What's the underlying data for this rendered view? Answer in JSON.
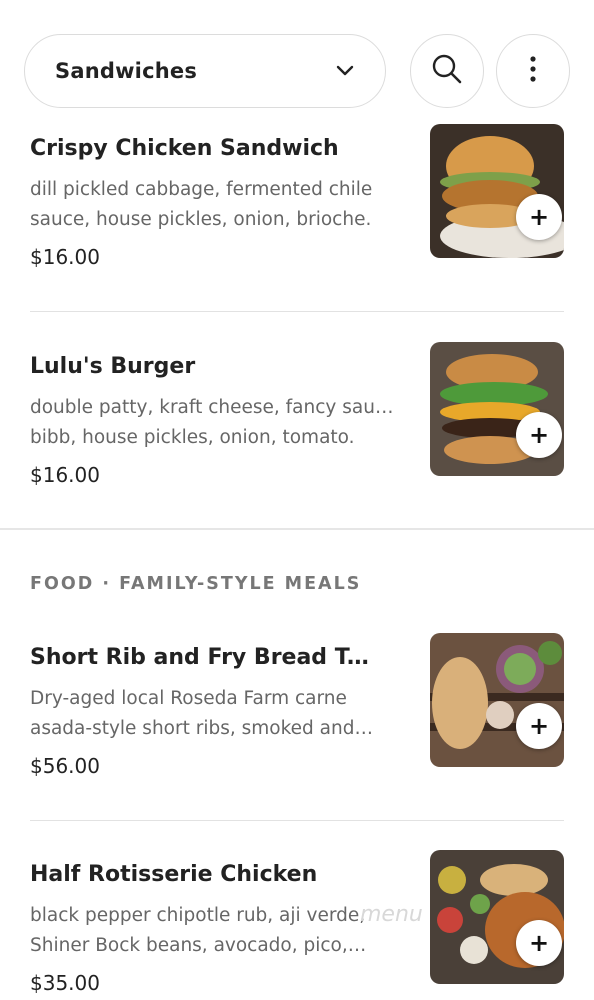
{
  "header": {
    "category_label": "Sandwiches",
    "icons": {
      "dropdown": "chevron-down-icon",
      "search": "search-icon",
      "more": "more-vertical-icon"
    }
  },
  "section_heading": "FOOD · FAMILY-STYLE MEALS",
  "items": [
    {
      "name": "Crispy Chicken Sandwich",
      "desc_line1": "dill pickled cabbage, fermented chile",
      "desc_line2": "sauce, house pickles, onion, brioche.",
      "price": "$16.00",
      "add_label": "+"
    },
    {
      "name": "Lulu's Burger",
      "desc_line1": "double patty, kraft cheese, fancy sauce,",
      "desc_line2": "bibb, house pickles, onion, tomato.",
      "price": "$16.00",
      "add_label": "+"
    },
    {
      "name": "Short Rib and Fry Bread Tacos…",
      "desc_line1": "Dry-aged local Roseda Farm carne",
      "desc_line2": "asada-style short ribs, smoked and…",
      "price": "$56.00",
      "add_label": "+"
    },
    {
      "name": "Half Rotisserie Chicken",
      "desc_line1": "black pepper chipotle rub, aji verde,",
      "desc_line2": "Shiner Bock beans, avocado, pico,…",
      "price": "$35.00",
      "add_label": "+"
    }
  ],
  "watermark": "menu"
}
